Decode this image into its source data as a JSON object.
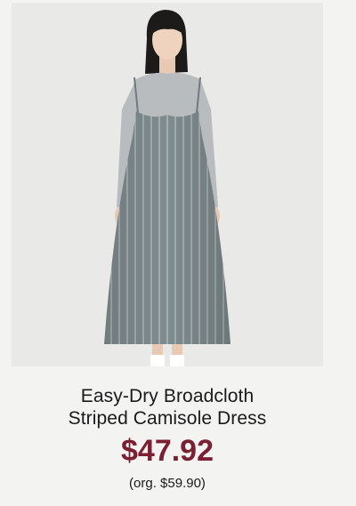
{
  "product": {
    "image_subject": "model-wearing-striped-camisole-dress",
    "title_line1": "Easy-Dry Broadcloth",
    "title_line2": "Striped Camisole Dress",
    "price": "$47.92",
    "original_price": "(org. $59.90)"
  },
  "colors": {
    "background": "#f3f3f1",
    "photo_background": "#e9e9e7",
    "price": "#7d1f33",
    "text": "#1a1a1a"
  }
}
